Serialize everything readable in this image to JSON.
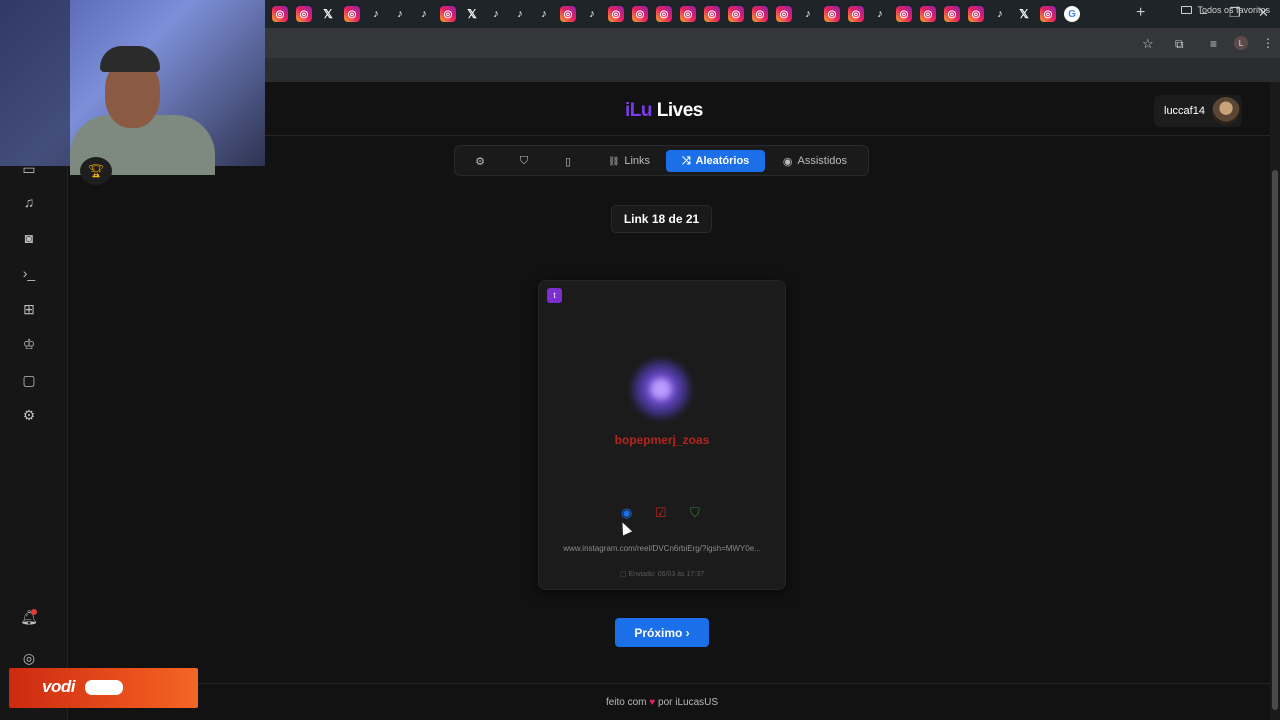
{
  "browser": {
    "tabs": [
      "instagram",
      "instagram",
      "x",
      "instagram",
      "tiktok",
      "tiktok",
      "tiktok",
      "instagram",
      "x",
      "tiktok",
      "tiktok",
      "tiktok",
      "instagram",
      "tiktok",
      "instagram",
      "instagram",
      "instagram",
      "instagram",
      "instagram",
      "instagram",
      "instagram",
      "instagram",
      "tiktok",
      "instagram",
      "instagram",
      "tiktok",
      "instagram",
      "instagram",
      "instagram",
      "instagram",
      "tiktok",
      "x",
      "instagram",
      "google"
    ],
    "new_tab": "+",
    "bookmarks_folder": "Todos os favoritos",
    "profile_initial": "L",
    "window_controls": {
      "minimize": "–",
      "maximize": "❐",
      "close": "✕"
    }
  },
  "app": {
    "brand": {
      "part1": "iLu",
      "part2": "Lives"
    },
    "user": {
      "name": "luccaf14"
    },
    "nav_tabs": [
      {
        "label": "",
        "icon": "gear-icon",
        "glyph": "⚙"
      },
      {
        "label": "",
        "icon": "shield-icon",
        "glyph": "⛉"
      },
      {
        "label": "",
        "icon": "tablet-icon",
        "glyph": "▯"
      },
      {
        "label": "Links",
        "icon": "link-icon",
        "glyph": "🔗"
      },
      {
        "label": "Aleatórios",
        "icon": "shuffle-icon",
        "glyph": "⤨",
        "active": true
      },
      {
        "label": "Assistidos",
        "icon": "eye-icon",
        "glyph": "◉"
      }
    ],
    "counter": "Link 18 de 21",
    "card": {
      "platform_badge": "t",
      "username": "bopepmerj_zoas",
      "url": "www.instagram.com/reel/DVCn6rbiErg/?igsh=MWY0e...",
      "sent": "Enviado: 06/03 às 17:37"
    },
    "next_button": "Próximo ›",
    "footer": {
      "prefix": "feito com",
      "heart": "♥",
      "suffix": "por iLucasUS"
    }
  },
  "sidebar_icons": [
    "monitor-icon",
    "music-icon",
    "camera-icon",
    "terminal-icon",
    "gift-icon",
    "award-icon",
    "message-icon",
    "settings-icon",
    "bell-icon",
    "help-icon"
  ],
  "overlay": {
    "logo": "vodi"
  },
  "colors": {
    "accent": "#1b6fe8",
    "brand_purple": "#7c3aed",
    "username_red": "#b3261e"
  }
}
